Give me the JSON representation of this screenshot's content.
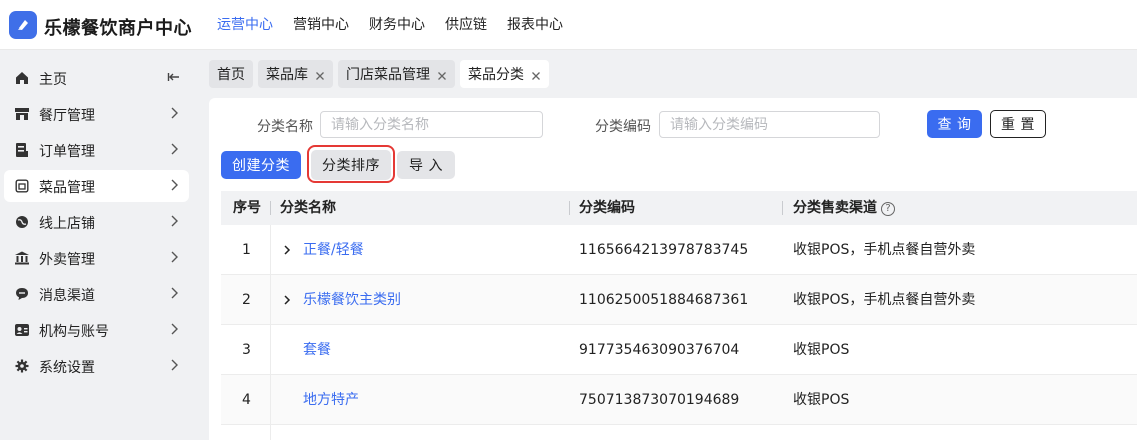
{
  "app": {
    "title": "乐檬餐饮商户中心"
  },
  "topnav": [
    {
      "label": "运营中心",
      "active": true
    },
    {
      "label": "营销中心",
      "active": false
    },
    {
      "label": "财务中心",
      "active": false
    },
    {
      "label": "供应链",
      "active": false
    },
    {
      "label": "报表中心",
      "active": false
    }
  ],
  "sidebar": {
    "items": [
      {
        "label": "主页",
        "icon": "home-icon"
      },
      {
        "label": "餐厅管理",
        "icon": "store-icon"
      },
      {
        "label": "订单管理",
        "icon": "order-icon"
      },
      {
        "label": "菜品管理",
        "icon": "dish-icon",
        "active": true
      },
      {
        "label": "线上店铺",
        "icon": "globe-icon"
      },
      {
        "label": "外卖管理",
        "icon": "bank-icon"
      },
      {
        "label": "消息渠道",
        "icon": "message-icon"
      },
      {
        "label": "机构与账号",
        "icon": "account-icon"
      },
      {
        "label": "系统设置",
        "icon": "gear-icon"
      }
    ]
  },
  "tabs": [
    {
      "label": "首页",
      "closable": false
    },
    {
      "label": "菜品库",
      "closable": true
    },
    {
      "label": "门店菜品管理",
      "closable": true
    },
    {
      "label": "菜品分类",
      "closable": true,
      "active": true
    }
  ],
  "filters": {
    "name_label": "分类名称",
    "name_placeholder": "请输入分类名称",
    "code_label": "分类编码",
    "code_placeholder": "请输入分类编码",
    "query_label": "查 询",
    "reset_label": "重 置"
  },
  "actions": {
    "create_label": "创建分类",
    "sort_label": "分类排序",
    "import_label": "导 入"
  },
  "table": {
    "columns": [
      "序号",
      "分类名称",
      "分类编码",
      "分类售卖渠道"
    ],
    "help_glyph": "?",
    "rows": [
      {
        "index": "1",
        "name": "正餐/轻餐",
        "code": "1165664213978783745",
        "channels": "收银POS，手机点餐自营外卖",
        "expandable": true
      },
      {
        "index": "2",
        "name": "乐檬餐饮主类别",
        "code": "1106250051884687361",
        "channels": "收银POS，手机点餐自营外卖",
        "expandable": true
      },
      {
        "index": "3",
        "name": "套餐",
        "code": "917735463090376704",
        "channels": "收银POS",
        "expandable": false
      },
      {
        "index": "4",
        "name": "地方特产",
        "code": "750713873070194689",
        "channels": "收银POS",
        "expandable": false
      }
    ]
  },
  "colors": {
    "accent": "#3a6cf0",
    "highlight": "#e53935"
  }
}
